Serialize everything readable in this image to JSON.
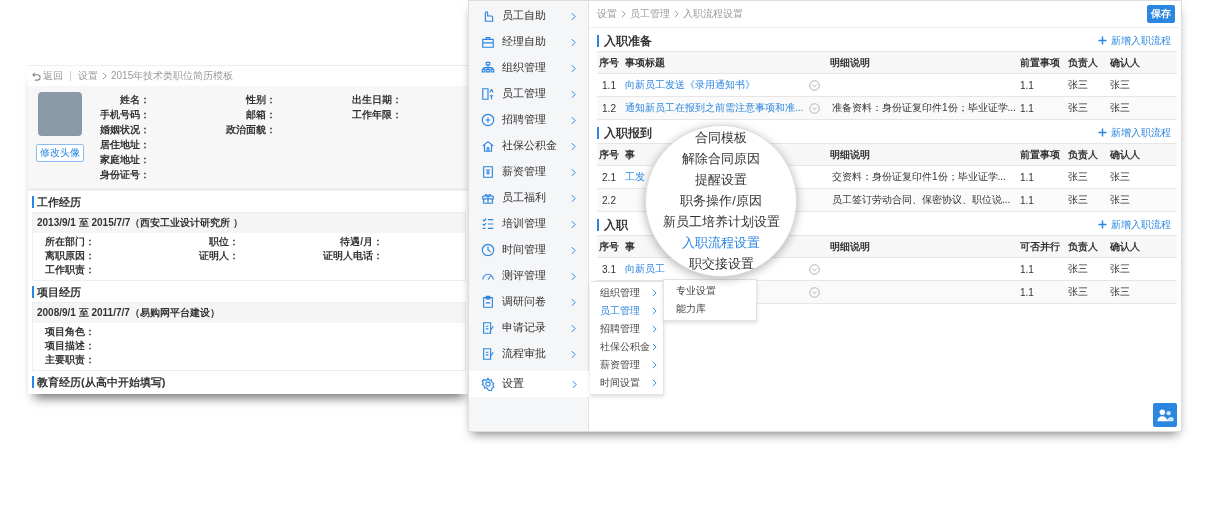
{
  "resume": {
    "back": "返回",
    "breadcrumb": [
      "设置",
      "2015年技术类职位简历模板"
    ],
    "change_photo": "修改头像",
    "profile_fields": [
      [
        "姓名：",
        "性别：",
        "出生日期："
      ],
      [
        "手机号码：",
        "邮箱：",
        "工作年限："
      ],
      [
        "婚姻状况：",
        "政治面貌："
      ],
      [
        "居住地址："
      ],
      [
        "家庭地址："
      ],
      [
        "身份证号："
      ]
    ],
    "sections": [
      {
        "title": "工作经历",
        "entries": [
          {
            "header": "2013/9/1 至 2015/7/7（西安工业设计研究所 ）",
            "fields": [
              [
                "所在部门：",
                "职位：",
                "待遇/月："
              ],
              [
                "离职原因：",
                "证明人：",
                "证明人电话："
              ],
              [
                "工作职责："
              ]
            ]
          }
        ]
      },
      {
        "title": "项目经历",
        "entries": [
          {
            "header": "2008/9/1 至 2011/7/7（易购网平台建设）",
            "fields": [
              [
                "项目角色："
              ],
              [
                "项目描述："
              ],
              [
                "主要职责："
              ]
            ]
          }
        ]
      },
      {
        "title": "教育经历(从高中开始填写)"
      }
    ]
  },
  "app": {
    "sidebar": [
      {
        "label": "员工自助",
        "selected": false
      },
      {
        "label": "经理自助",
        "selected": false
      },
      {
        "label": "组织管理",
        "selected": false
      },
      {
        "label": "员工管理",
        "selected": false
      },
      {
        "label": "招聘管理",
        "selected": false
      },
      {
        "label": "社保公积金",
        "selected": false
      },
      {
        "label": "薪资管理",
        "selected": false
      },
      {
        "label": "员工福利",
        "selected": false
      },
      {
        "label": "培训管理",
        "selected": false
      },
      {
        "label": "时间管理",
        "selected": false
      },
      {
        "label": "测评管理",
        "selected": false
      },
      {
        "label": "调研问卷",
        "selected": false
      },
      {
        "label": "申请记录",
        "selected": false
      },
      {
        "label": "流程审批",
        "selected": false
      },
      {
        "label": "设置",
        "selected": true
      }
    ],
    "breadcrumb": [
      "设置",
      "员工管理",
      "入职流程设置"
    ],
    "save": "保存",
    "sections": [
      {
        "title": "入职准备",
        "add": "新增入职流程",
        "columns": [
          "序号",
          "事项标题",
          "明细说明",
          "前置事项",
          "负责人",
          "确认人"
        ],
        "rows": [
          {
            "seq": "1.1",
            "title": "向新员工发送《录用通知书》",
            "dropdown": true,
            "prereq": "1.1",
            "owner": "张三",
            "confirmer": "张三"
          },
          {
            "seq": "1.2",
            "title": "通知新员工在报到之前需注意事项和准...",
            "dropdown": true,
            "detail": "准备资料：身份证复印件1份；毕业证学...",
            "prereq": "1.1",
            "owner": "张三",
            "confirmer": "张三"
          }
        ]
      },
      {
        "title": "入职报到",
        "add": "新增入职流程",
        "columns": [
          "序号",
          "事",
          "明细说明",
          "前置事项",
          "负责人",
          "确认人"
        ],
        "rows": [
          {
            "seq": "2.1",
            "title": "工发",
            "dropdown": false,
            "detail": "交资料：身份证复印件1份；毕业证学...",
            "prereq": "1.1",
            "owner": "张三",
            "confirmer": "张三"
          },
          {
            "seq": "2.2",
            "dropdown": false,
            "detail": "员工签订劳动合同、保密协议、职位说...",
            "prereq": "1.1",
            "owner": "张三",
            "confirmer": "张三"
          }
        ]
      },
      {
        "title": "入职",
        "add": "新增入职流程",
        "columns": [
          "序号",
          "事",
          "明细说明",
          "可否并行",
          "负责人",
          "确认人"
        ],
        "rows": [
          {
            "seq": "3.1",
            "title": "向新员工",
            "dropdown": true,
            "prereq": "1.1",
            "owner": "张三",
            "confirmer": "张三"
          },
          {
            "dropdown": true,
            "prereq": "1.1",
            "owner": "张三",
            "confirmer": "张三"
          }
        ]
      }
    ],
    "submenu": [
      {
        "label": "组织管理",
        "selected": false
      },
      {
        "label": "员工管理",
        "selected": true
      },
      {
        "label": "招聘管理",
        "selected": false
      },
      {
        "label": "社保公积金",
        "selected": false
      },
      {
        "label": "薪资管理",
        "selected": false
      },
      {
        "label": "时间设置",
        "selected": false
      }
    ],
    "lens_menu": [
      {
        "label": "合同模板",
        "selected": false
      },
      {
        "label": "解除合同原因",
        "selected": false
      },
      {
        "label": "提醒设置",
        "selected": false
      },
      {
        "label": "职务操作/原因",
        "selected": false
      },
      {
        "label": "新员工培养计划设置",
        "selected": false
      },
      {
        "label": "入职流程设置",
        "selected": true
      },
      {
        "label": "职交接设置",
        "selected": false
      }
    ],
    "third_menu": [
      {
        "label": "专业设置",
        "selected": false
      },
      {
        "label": "能力库",
        "selected": false
      }
    ]
  }
}
